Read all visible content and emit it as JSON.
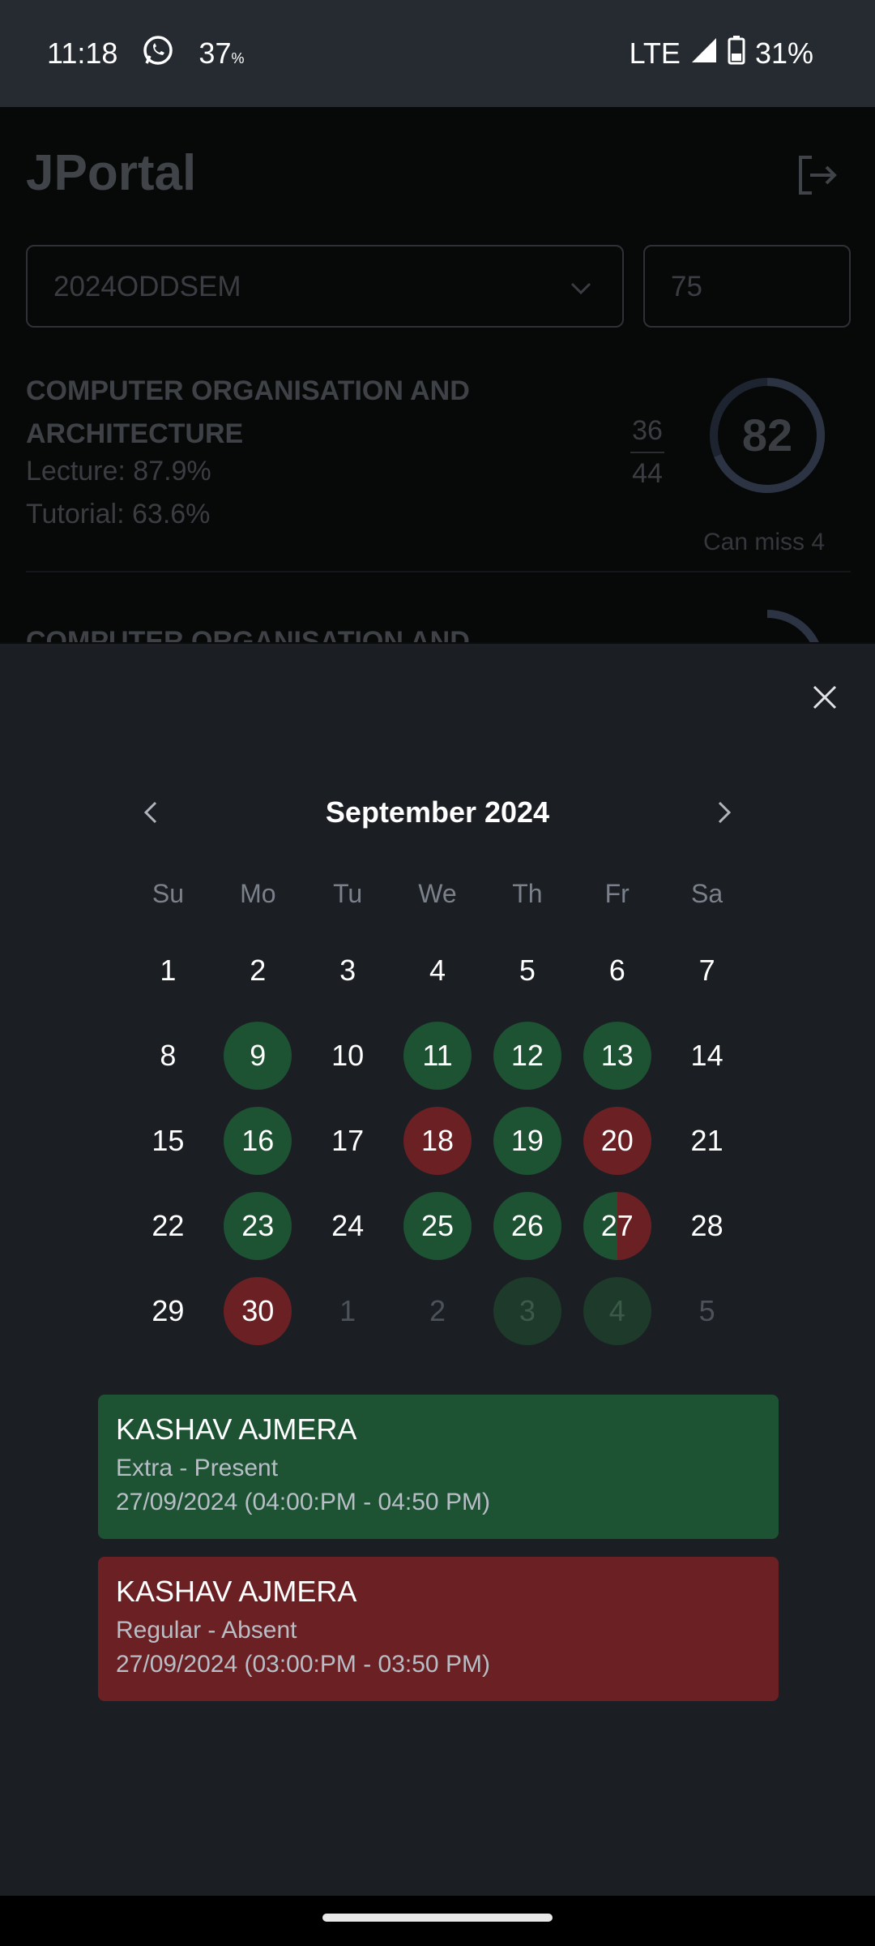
{
  "status_bar": {
    "time": "11:18",
    "temp": "37",
    "temp_unit": "%",
    "network": "LTE",
    "battery": "31%"
  },
  "background": {
    "app_title": "JPortal",
    "semester_select": "2024ODDSEM",
    "target_input": "75",
    "course1": {
      "name": "COMPUTER ORGANISATION AND ARCHITECTURE",
      "lecture": "Lecture: 87.9%",
      "tutorial": "Tutorial: 63.6%",
      "attended": "36",
      "total": "44",
      "percent": "82",
      "can_miss": "Can miss 4"
    },
    "course2": {
      "name": "COMPUTER ORGANISATION AND"
    }
  },
  "calendar": {
    "month_title": "September 2024",
    "weekdays": [
      "Su",
      "Mo",
      "Tu",
      "We",
      "Th",
      "Fr",
      "Sa"
    ],
    "weeks": [
      [
        {
          "d": "1",
          "s": "none"
        },
        {
          "d": "2",
          "s": "none"
        },
        {
          "d": "3",
          "s": "none"
        },
        {
          "d": "4",
          "s": "none"
        },
        {
          "d": "5",
          "s": "none"
        },
        {
          "d": "6",
          "s": "none"
        },
        {
          "d": "7",
          "s": "none"
        }
      ],
      [
        {
          "d": "8",
          "s": "none"
        },
        {
          "d": "9",
          "s": "present"
        },
        {
          "d": "10",
          "s": "none"
        },
        {
          "d": "11",
          "s": "present"
        },
        {
          "d": "12",
          "s": "present"
        },
        {
          "d": "13",
          "s": "present"
        },
        {
          "d": "14",
          "s": "none"
        }
      ],
      [
        {
          "d": "15",
          "s": "none"
        },
        {
          "d": "16",
          "s": "present"
        },
        {
          "d": "17",
          "s": "none"
        },
        {
          "d": "18",
          "s": "absent"
        },
        {
          "d": "19",
          "s": "present"
        },
        {
          "d": "20",
          "s": "absent"
        },
        {
          "d": "21",
          "s": "none"
        }
      ],
      [
        {
          "d": "22",
          "s": "none"
        },
        {
          "d": "23",
          "s": "present"
        },
        {
          "d": "24",
          "s": "none"
        },
        {
          "d": "25",
          "s": "present"
        },
        {
          "d": "26",
          "s": "present"
        },
        {
          "d": "27",
          "s": "mixed"
        },
        {
          "d": "28",
          "s": "none"
        }
      ],
      [
        {
          "d": "29",
          "s": "none"
        },
        {
          "d": "30",
          "s": "absent"
        },
        {
          "d": "1",
          "s": "other"
        },
        {
          "d": "2",
          "s": "other"
        },
        {
          "d": "3",
          "s": "faded"
        },
        {
          "d": "4",
          "s": "faded"
        },
        {
          "d": "5",
          "s": "other"
        }
      ]
    ]
  },
  "sessions": [
    {
      "name": "KASHAV AJMERA",
      "type": "Extra - Present",
      "time": "27/09/2024 (04:00:PM - 04:50 PM)"
    },
    {
      "name": "KASHAV AJMERA",
      "type": "Regular - Absent",
      "time": "27/09/2024 (03:00:PM - 03:50 PM)"
    }
  ],
  "colors": {
    "present": "#1d5233",
    "absent": "#6b2124",
    "sheet_bg": "#1b1e23",
    "status_bar_bg": "#262b32"
  }
}
